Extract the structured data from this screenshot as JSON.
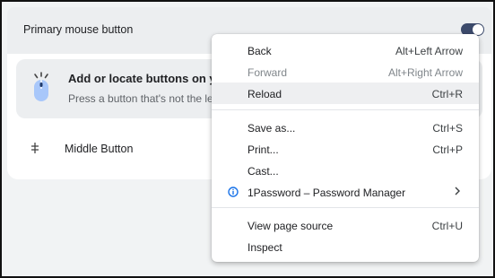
{
  "settings": {
    "primary_button_label": "Primary mouse button",
    "primary_toggle_on": true,
    "info_title": "Add or locate buttons on your",
    "info_desc": "Press a button that's not the left o",
    "middle_button_label": "Middle Button"
  },
  "menu": {
    "items": [
      {
        "label": "Back",
        "shortcut": "Alt+Left Arrow"
      },
      {
        "label": "Forward",
        "shortcut": "Alt+Right Arrow",
        "disabled": true
      },
      {
        "label": "Reload",
        "shortcut": "Ctrl+R",
        "hovered": true
      },
      {
        "label": "Save as...",
        "shortcut": "Ctrl+S"
      },
      {
        "label": "Print...",
        "shortcut": "Ctrl+P"
      },
      {
        "label": "Cast...",
        "shortcut": ""
      },
      {
        "label": "1Password – Password Manager",
        "shortcut": "",
        "icon": "info-icon",
        "submenu": true
      },
      {
        "label": "View page source",
        "shortcut": "Ctrl+U"
      },
      {
        "label": "Inspect",
        "shortcut": ""
      }
    ]
  },
  "colors": {
    "accent": "#3c4a6b",
    "info_icon": "#1a73e8",
    "mouse_icon": "#a8c7fa"
  }
}
